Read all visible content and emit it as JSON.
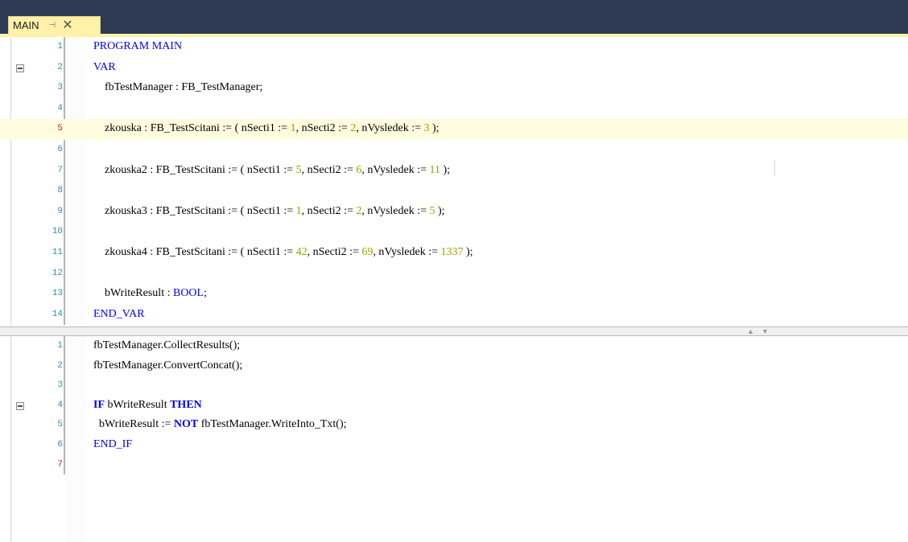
{
  "tab": {
    "title": "MAIN",
    "pin_glyph": "⊣",
    "close_glyph": "✕"
  },
  "colors": {
    "keyword": "#0000ff",
    "number": "#a0a000",
    "line_number": "#2b91af",
    "modified_line_number": "#c8202b",
    "tab_background": "#fff1a9",
    "title_bar": "#2d3a52"
  },
  "icons": {
    "fold": "collapse-minus-icon",
    "pin": "pin-icon",
    "close": "close-icon",
    "splitter_up": "triangle-up-icon",
    "splitter_down": "triangle-down-icon"
  },
  "declaration": {
    "lines": [
      {
        "n": "1",
        "modified": false,
        "segments": [
          {
            "t": "PROGRAM MAIN",
            "c": "kw"
          }
        ]
      },
      {
        "n": "2",
        "modified": false,
        "fold": true,
        "segments": [
          {
            "t": "VAR",
            "c": "kw"
          }
        ]
      },
      {
        "n": "3",
        "modified": false,
        "segments": [
          {
            "t": "    fbTestManager : FB_TestManager;",
            "c": ""
          }
        ]
      },
      {
        "n": "4",
        "modified": false,
        "segments": []
      },
      {
        "n": "5",
        "modified": true,
        "highlight": true,
        "segments": [
          {
            "t": "    zkouska : FB_TestScitani := ( nSecti1 := ",
            "c": ""
          },
          {
            "t": "1",
            "c": "num"
          },
          {
            "t": ", nSecti2 := ",
            "c": ""
          },
          {
            "t": "2",
            "c": "num"
          },
          {
            "t": ", nVysledek := ",
            "c": ""
          },
          {
            "t": "3",
            "c": "num"
          },
          {
            "t": " );",
            "c": ""
          }
        ]
      },
      {
        "n": "6",
        "modified": false,
        "segments": []
      },
      {
        "n": "7",
        "modified": false,
        "segments": [
          {
            "t": "    zkouska2 : FB_TestScitani := ( nSecti1 := ",
            "c": ""
          },
          {
            "t": "5",
            "c": "num"
          },
          {
            "t": ", nSecti2 := ",
            "c": ""
          },
          {
            "t": "6",
            "c": "num"
          },
          {
            "t": ", nVysledek := ",
            "c": ""
          },
          {
            "t": "11",
            "c": "num"
          },
          {
            "t": " );",
            "c": ""
          }
        ]
      },
      {
        "n": "8",
        "modified": false,
        "segments": []
      },
      {
        "n": "9",
        "modified": false,
        "segments": [
          {
            "t": "    zkouska3 : FB_TestScitani := ( nSecti1 := ",
            "c": ""
          },
          {
            "t": "1",
            "c": "num"
          },
          {
            "t": ", nSecti2 := ",
            "c": ""
          },
          {
            "t": "2",
            "c": "num"
          },
          {
            "t": ", nVysledek := ",
            "c": ""
          },
          {
            "t": "5",
            "c": "num"
          },
          {
            "t": " );",
            "c": ""
          }
        ]
      },
      {
        "n": "10",
        "modified": false,
        "segments": []
      },
      {
        "n": "11",
        "modified": false,
        "segments": [
          {
            "t": "    zkouska4 : FB_TestScitani := ( nSecti1 := ",
            "c": ""
          },
          {
            "t": "42",
            "c": "num"
          },
          {
            "t": ", nSecti2 := ",
            "c": ""
          },
          {
            "t": "69",
            "c": "num"
          },
          {
            "t": ", nVysledek := ",
            "c": ""
          },
          {
            "t": "1337",
            "c": "num"
          },
          {
            "t": " );",
            "c": ""
          }
        ]
      },
      {
        "n": "12",
        "modified": false,
        "segments": []
      },
      {
        "n": "13",
        "modified": false,
        "segments": [
          {
            "t": "    bWriteResult : ",
            "c": ""
          },
          {
            "t": "BOOL",
            "c": "kw"
          },
          {
            "t": ";",
            "c": ""
          }
        ]
      },
      {
        "n": "14",
        "modified": false,
        "segments": [
          {
            "t": "END_VAR",
            "c": "kw"
          }
        ]
      }
    ]
  },
  "implementation": {
    "lines": [
      {
        "n": "1",
        "modified": false,
        "segments": [
          {
            "t": "fbTestManager.CollectResults();",
            "c": ""
          }
        ]
      },
      {
        "n": "2",
        "modified": false,
        "segments": [
          {
            "t": "fbTestManager.ConvertConcat();",
            "c": ""
          }
        ]
      },
      {
        "n": "3",
        "modified": false,
        "segments": []
      },
      {
        "n": "4",
        "modified": false,
        "fold": true,
        "segments": [
          {
            "t": "IF",
            "c": "kwb"
          },
          {
            "t": " bWriteResult ",
            "c": ""
          },
          {
            "t": "THEN",
            "c": "kwb"
          }
        ]
      },
      {
        "n": "5",
        "modified": false,
        "segments": [
          {
            "t": "  bWriteResult := ",
            "c": ""
          },
          {
            "t": "NOT",
            "c": "kwb"
          },
          {
            "t": " fbTestManager.WriteInto_Txt();",
            "c": ""
          }
        ]
      },
      {
        "n": "6",
        "modified": false,
        "segments": [
          {
            "t": "END_IF",
            "c": "kw"
          }
        ]
      },
      {
        "n": "7",
        "modified": true,
        "segments": []
      }
    ]
  }
}
